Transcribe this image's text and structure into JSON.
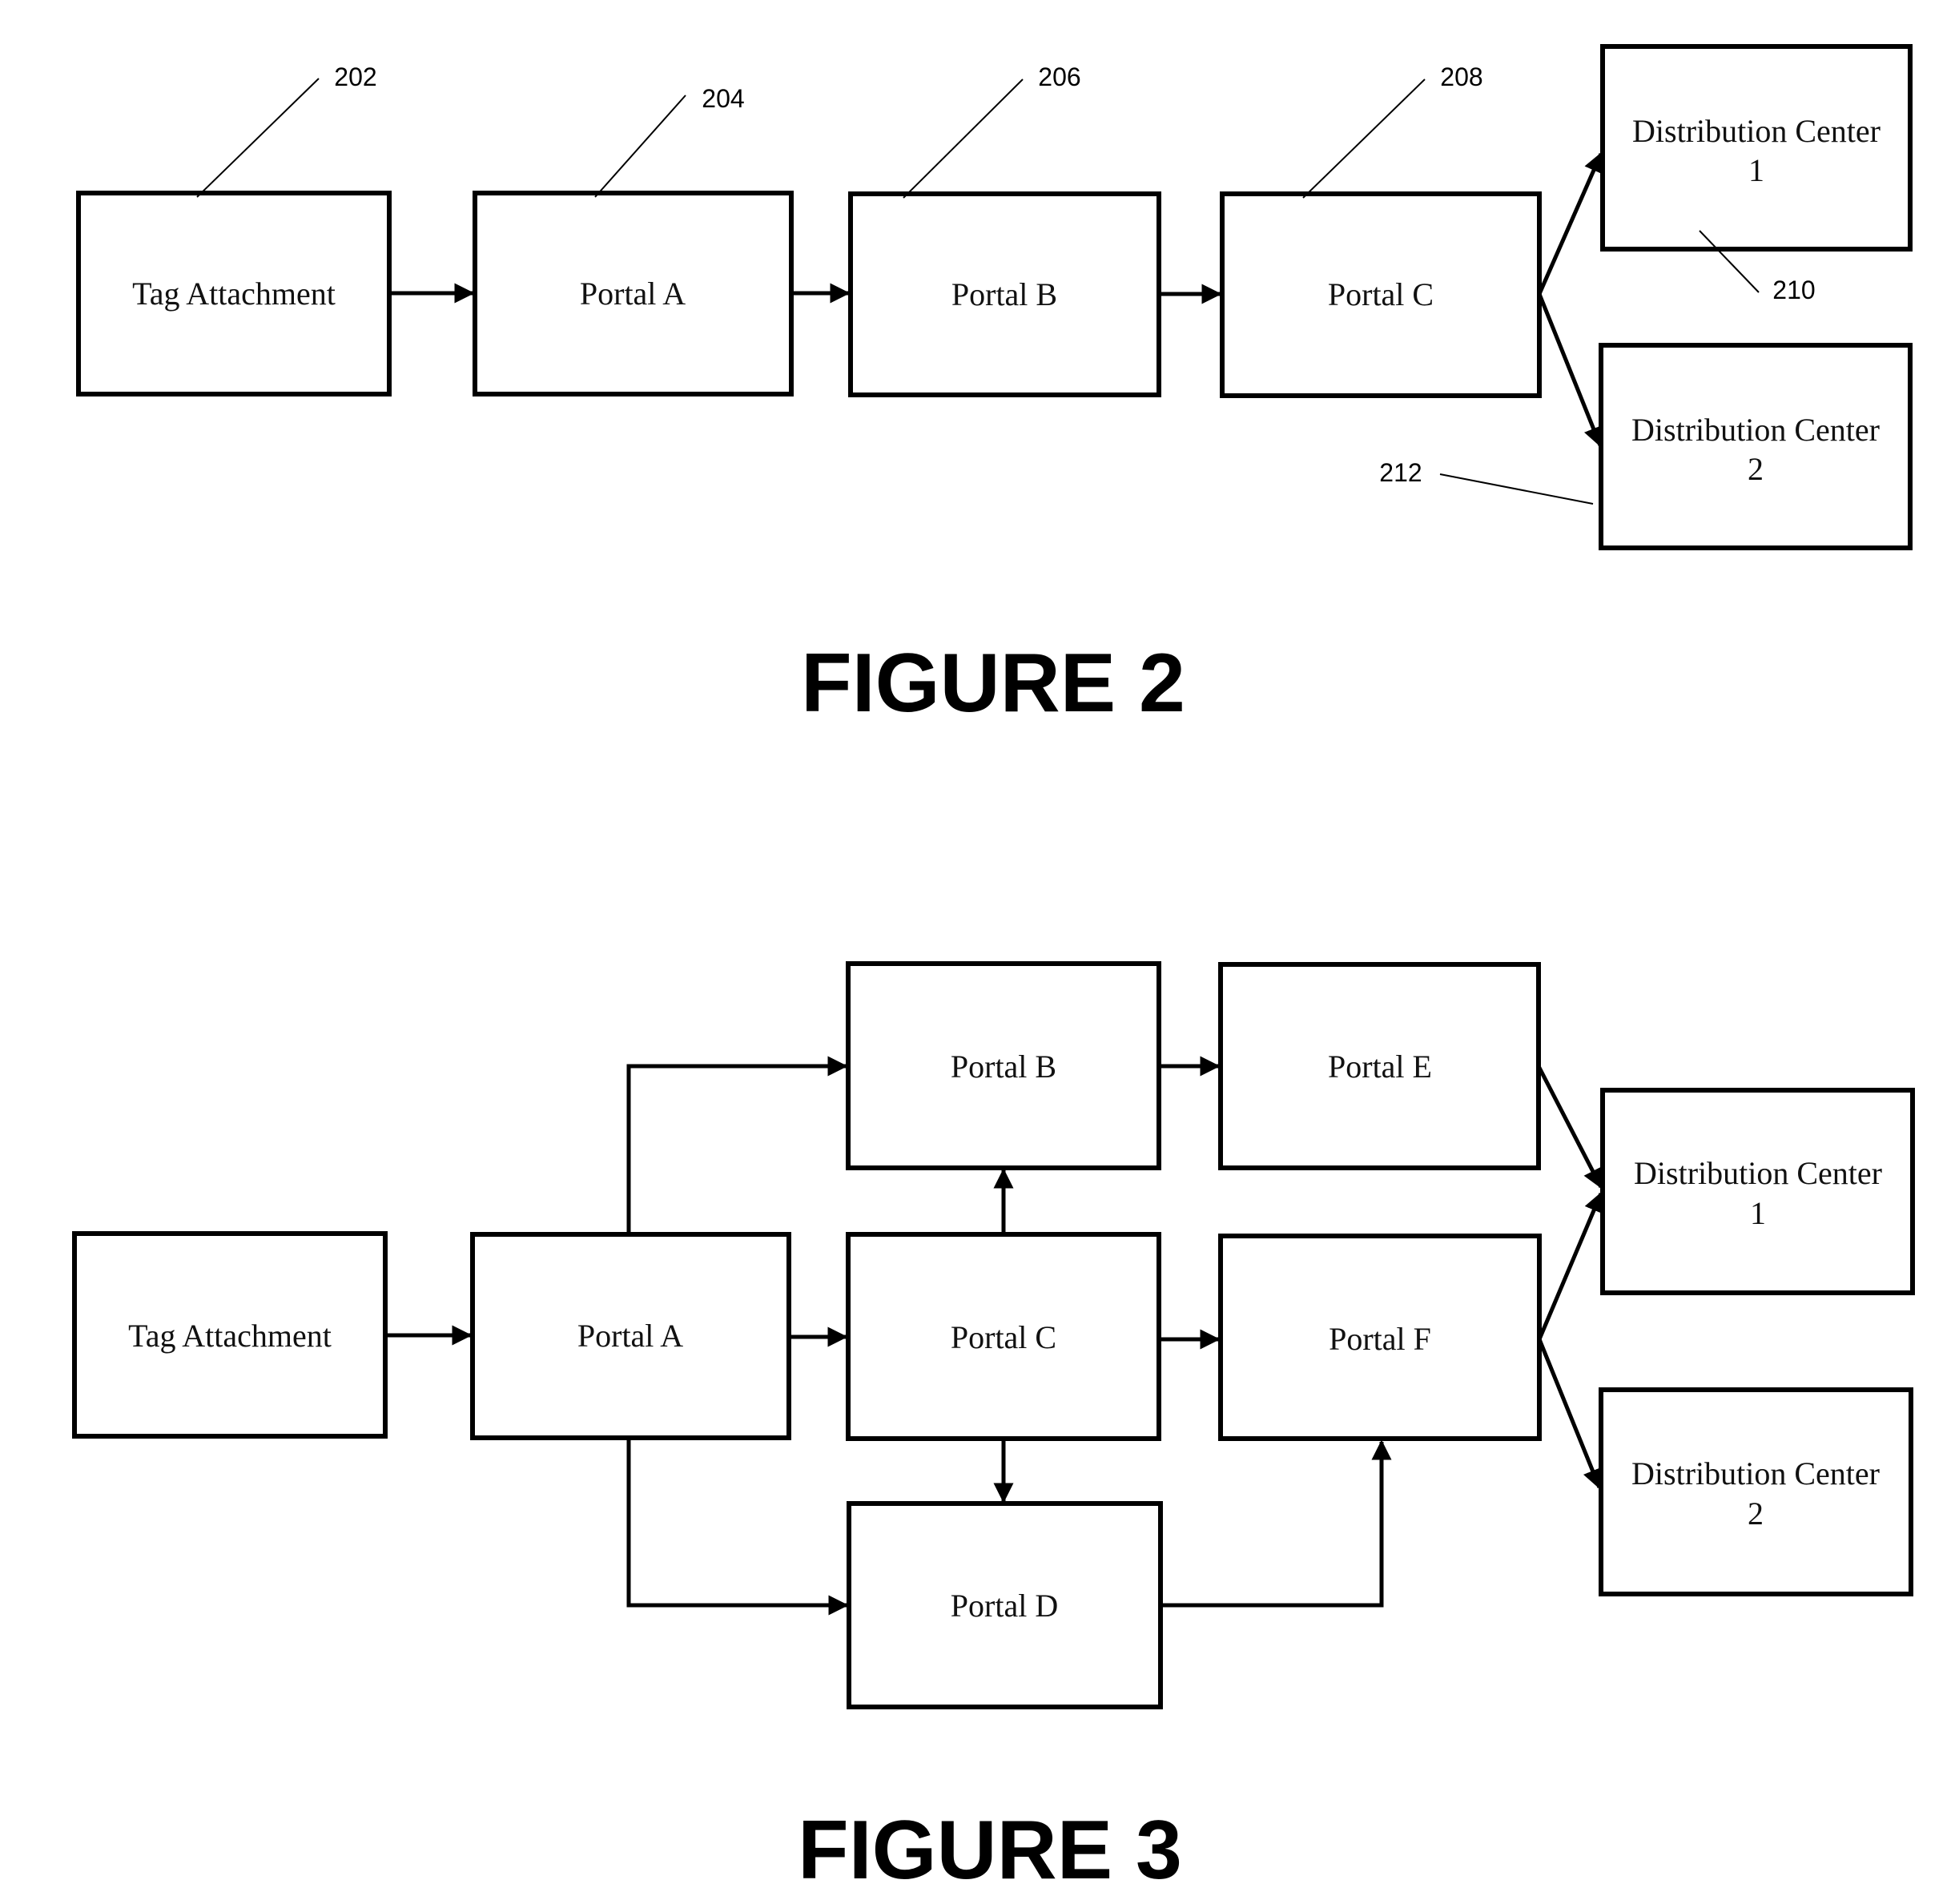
{
  "figures": [
    {
      "title": "FIGURE 2",
      "nodes": [
        {
          "id": "tag",
          "lines": [
            "Tag Attachment"
          ]
        },
        {
          "id": "portalA",
          "lines": [
            "Portal A"
          ]
        },
        {
          "id": "portalB",
          "lines": [
            "Portal B"
          ]
        },
        {
          "id": "portalC",
          "lines": [
            "Portal C"
          ]
        },
        {
          "id": "dc1",
          "lines": [
            "Distribution Center",
            "1"
          ]
        },
        {
          "id": "dc2",
          "lines": [
            "Distribution Center",
            "2"
          ]
        }
      ],
      "edges": [
        {
          "from": "tag",
          "to": "portalA"
        },
        {
          "from": "portalA",
          "to": "portalB"
        },
        {
          "from": "portalB",
          "to": "portalC"
        },
        {
          "from": "portalC",
          "to": "dc1"
        },
        {
          "from": "portalC",
          "to": "dc2"
        }
      ],
      "reference_numerals": [
        {
          "label": "202",
          "target": "tag"
        },
        {
          "label": "204",
          "target": "portalA"
        },
        {
          "label": "206",
          "target": "portalB"
        },
        {
          "label": "208",
          "target": "portalC"
        },
        {
          "label": "210",
          "target": "dc1"
        },
        {
          "label": "212",
          "target": "dc2"
        }
      ]
    },
    {
      "title": "FIGURE 3",
      "nodes": [
        {
          "id": "tag",
          "lines": [
            "Tag Attachment"
          ]
        },
        {
          "id": "portalA",
          "lines": [
            "Portal A"
          ]
        },
        {
          "id": "portalB",
          "lines": [
            "Portal B"
          ]
        },
        {
          "id": "portalC",
          "lines": [
            "Portal C"
          ]
        },
        {
          "id": "portalD",
          "lines": [
            "Portal D"
          ]
        },
        {
          "id": "portalE",
          "lines": [
            "Portal E"
          ]
        },
        {
          "id": "portalF",
          "lines": [
            "Portal F"
          ]
        },
        {
          "id": "dc1",
          "lines": [
            "Distribution Center",
            "1"
          ]
        },
        {
          "id": "dc2",
          "lines": [
            "Distribution Center",
            "2"
          ]
        }
      ],
      "edges": [
        {
          "from": "tag",
          "to": "portalA"
        },
        {
          "from": "portalA",
          "to": "portalB"
        },
        {
          "from": "portalA",
          "to": "portalC"
        },
        {
          "from": "portalA",
          "to": "portalD"
        },
        {
          "from": "portalC",
          "to": "portalB"
        },
        {
          "from": "portalC",
          "to": "portalD"
        },
        {
          "from": "portalC",
          "to": "portalF"
        },
        {
          "from": "portalB",
          "to": "portalE"
        },
        {
          "from": "portalD",
          "to": "portalF"
        },
        {
          "from": "portalE",
          "to": "dc1"
        },
        {
          "from": "portalF",
          "to": "dc1"
        },
        {
          "from": "portalF",
          "to": "dc2"
        }
      ],
      "reference_numerals": []
    }
  ]
}
